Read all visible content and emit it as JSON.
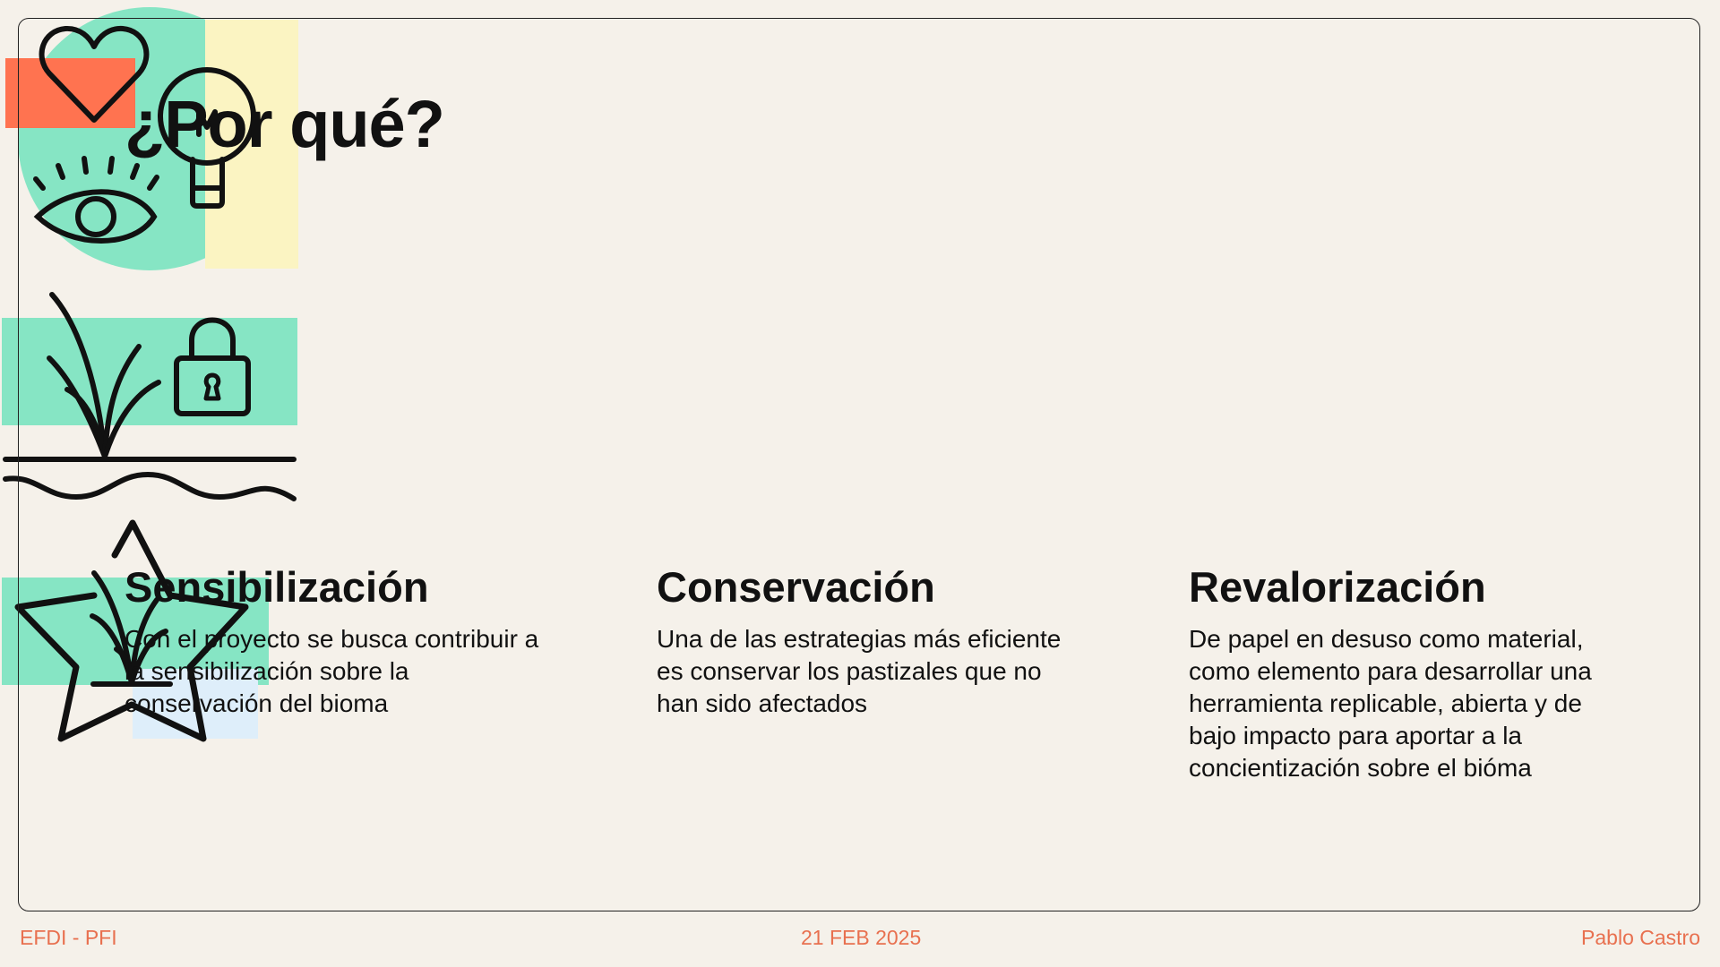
{
  "slide": {
    "title": "¿Por qué?",
    "columns": [
      {
        "heading": "Sensibilización",
        "text": "Con el proyecto se busca contribuir a la sensibilización sobre la conservación del bioma",
        "icons": [
          "heart-icon",
          "lightbulb-icon",
          "eye-icon"
        ]
      },
      {
        "heading": "Conservación",
        "text": "Una de las estrategias más eficiente es conservar los pastizales que no han sido afectados",
        "icons": [
          "grass-icon",
          "padlock-icon",
          "wave-icon"
        ]
      },
      {
        "heading": "Revalorización",
        "text": "De papel en desuso como material, como elemento para desarrollar una herramienta replicable, abierta y de bajo impacto para aportar a la concientización sobre el bióma",
        "icons": [
          "star-icon",
          "grass-icon"
        ]
      }
    ]
  },
  "footer": {
    "left": "EFDI - PFI",
    "center": "21 FEB 2025",
    "right": "Pablo Castro"
  },
  "colors": {
    "background": "#f5f1ea",
    "accent": "#e8704f",
    "mint": "#86e5c4",
    "coral": "#ff7350",
    "pale_yellow": "#fbf4c2",
    "pale_blue": "#deeefa"
  }
}
